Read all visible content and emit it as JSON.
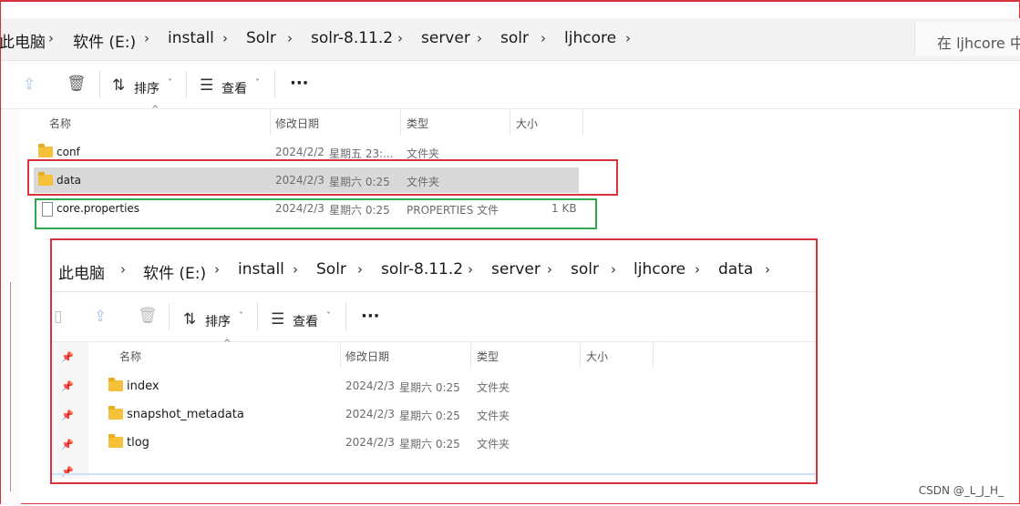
{
  "breadcrumb": {
    "items": [
      "此电脑",
      "软件 (E:)",
      "install",
      "Solr",
      "solr-8.11.2",
      "server",
      "solr",
      "ljhcore"
    ],
    "search_placeholder": "在 ljhcore 中"
  },
  "toolbar": {
    "sort_label": "排序",
    "view_label": "查看",
    "more_label": "···"
  },
  "columns": {
    "name": "名称",
    "modified": "修改日期",
    "type": "类型",
    "size": "大小"
  },
  "files": [
    {
      "name": "conf",
      "date": "2024/2/2",
      "day": "星期五 23:...",
      "type": "文件夹",
      "size": "",
      "kind": "folder"
    },
    {
      "name": "data",
      "date": "2024/2/3",
      "day": "星期六 0:25",
      "type": "文件夹",
      "size": "",
      "kind": "folder"
    },
    {
      "name": "core.properties",
      "date": "2024/2/3",
      "day": "星期六 0:25",
      "type": "PROPERTIES 文件",
      "size": "1 KB",
      "kind": "file"
    }
  ],
  "inner": {
    "breadcrumb": [
      "此电脑",
      "软件 (E:)",
      "install",
      "Solr",
      "solr-8.11.2",
      "server",
      "solr",
      "ljhcore",
      "data"
    ],
    "toolbar": {
      "sort_label": "排序",
      "view_label": "查看",
      "more_label": "···"
    },
    "columns": {
      "name": "名称",
      "modified": "修改日期",
      "type": "类型",
      "size": "大小"
    },
    "files": [
      {
        "name": "index",
        "date": "2024/2/3",
        "day": "星期六 0:25",
        "type": "文件夹"
      },
      {
        "name": "snapshot_metadata",
        "date": "2024/2/3",
        "day": "星期六 0:25",
        "type": "文件夹"
      },
      {
        "name": "tlog",
        "date": "2024/2/3",
        "day": "星期六 0:25",
        "type": "文件夹"
      }
    ]
  },
  "watermark": "CSDN @_L_J_H_",
  "colors": {
    "highlight_red": "#d6343c",
    "highlight_green": "#2ea84a",
    "folder": "#f5c13a",
    "selected_row": "#d9d9d9"
  }
}
